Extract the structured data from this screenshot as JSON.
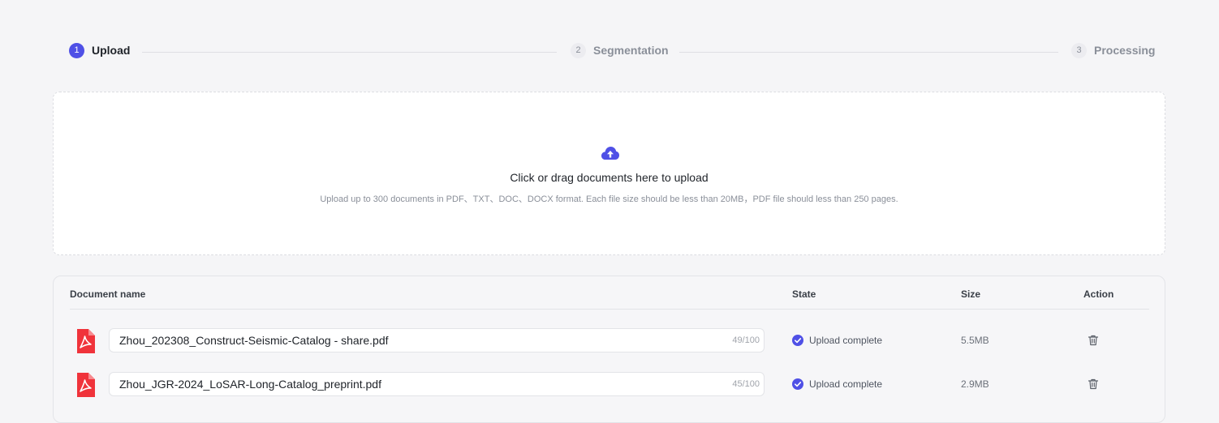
{
  "steps": [
    {
      "number": "1",
      "label": "Upload",
      "state": "active"
    },
    {
      "number": "2",
      "label": "Segmentation",
      "state": "inactive"
    },
    {
      "number": "3",
      "label": "Processing",
      "state": "inactive"
    }
  ],
  "dropzone": {
    "icon": "cloud-upload-icon",
    "title": "Click or drag documents here to upload",
    "hint": "Upload up to 300 documents in PDF、TXT、DOC、DOCX format. Each file size should be less than 20MB，PDF file should less than 250 pages."
  },
  "table": {
    "headers": {
      "name": "Document name",
      "state": "State",
      "size": "Size",
      "action": "Action"
    },
    "rows": [
      {
        "name": "Zhou_202308_Construct-Seismic-Catalog - share.pdf",
        "count": "49/100",
        "state": "Upload complete",
        "size": "5.5MB"
      },
      {
        "name": "Zhou_JGR-2024_LoSAR-Long-Catalog_preprint.pdf",
        "count": "45/100",
        "state": "Upload complete",
        "size": "2.9MB"
      }
    ]
  },
  "colors": {
    "accent": "#4f50e6",
    "pdf": "#f0333b"
  }
}
